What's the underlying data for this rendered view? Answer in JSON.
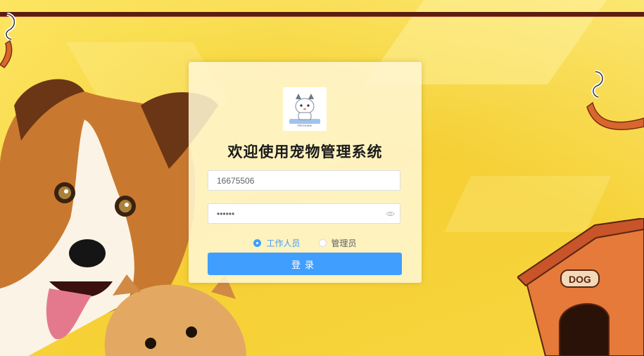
{
  "login": {
    "title": "欢迎使用宠物管理系统",
    "username_value": "16675506",
    "password_value": "••••••",
    "roles": [
      {
        "label": "工作人员",
        "checked": true
      },
      {
        "label": "管理员",
        "checked": false
      }
    ],
    "submit_label": "登录"
  },
  "logo": {
    "caption": "Pet Home"
  },
  "house": {
    "sign": "DOG"
  },
  "colors": {
    "primary": "#409eff",
    "background": "#f6d13a"
  }
}
